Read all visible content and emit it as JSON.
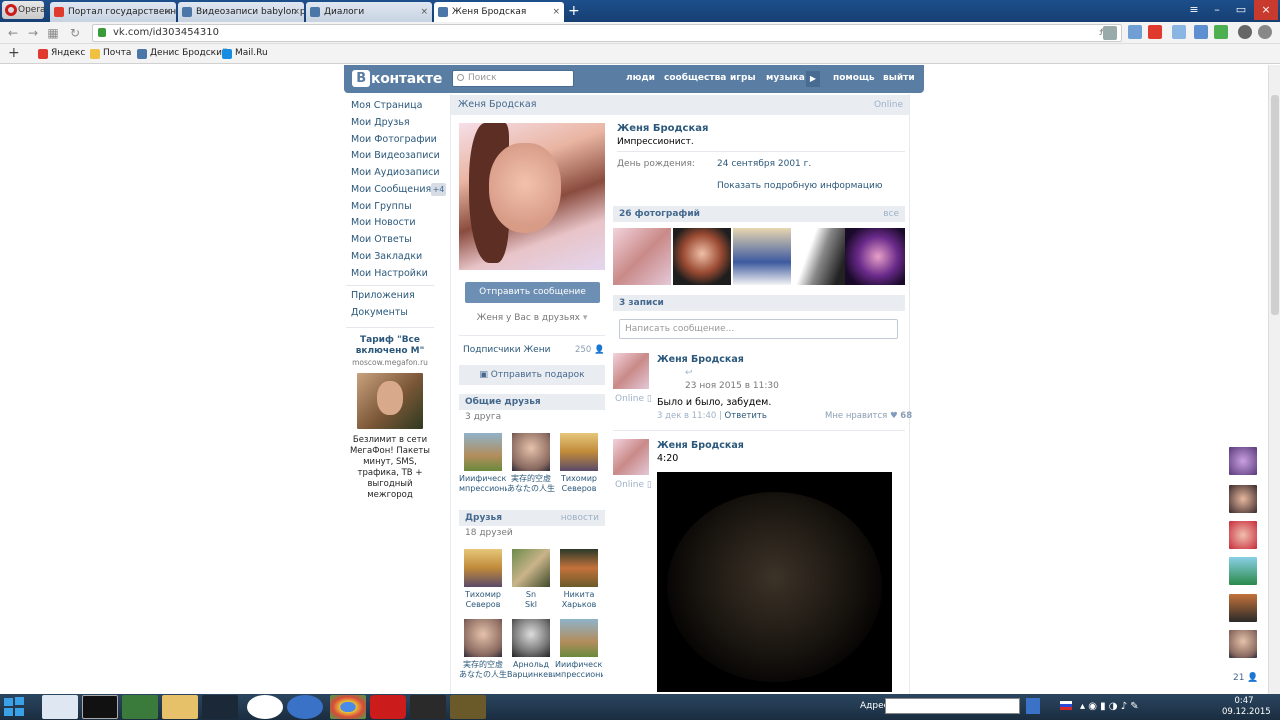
{
  "browser": {
    "opera_label": "Opera",
    "tabs": [
      {
        "title": "Портал государственных"
      },
      {
        "title": "Видеозаписи babylon po"
      },
      {
        "title": "Диалоги"
      },
      {
        "title": "Женя Бродская"
      }
    ],
    "new_tab": "+",
    "url": "vk.com/id303454310",
    "translate_label": "Ꝭ A",
    "bookmarks": [
      {
        "label": "Яндекс",
        "color": "#e03a2f"
      },
      {
        "label": "Почта",
        "color": "#f0c040"
      },
      {
        "label": "Денис Бродский",
        "color": "#4a76a8"
      },
      {
        "label": "Mail.Ru",
        "color": "#168de2"
      }
    ]
  },
  "vk_header": {
    "logo_box": "В",
    "logo_text": "контакте",
    "search_placeholder": "Поиск",
    "nav": [
      "люди",
      "сообщества",
      "игры",
      "музыка",
      "помощь",
      "выйти"
    ]
  },
  "left_menu": {
    "items": [
      "Моя Страница",
      "Мои Друзья",
      "Мои Фотографии",
      "Мои Видеозаписи",
      "Мои Аудиозаписи",
      "Мои Сообщения",
      "Мои Группы",
      "Мои Новости",
      "Мои Ответы",
      "Мои Закладки",
      "Мои Настройки"
    ],
    "messages_badge": "+4",
    "extra": [
      "Приложения",
      "Документы"
    ],
    "ad": {
      "title": "Тариф \"Все включено М\"",
      "domain": "moscow.megafon.ru",
      "text": "Безлимит в сети МегаФон! Пакеты минут, SMS, трафика, ТВ + выгодный межгород"
    }
  },
  "profile": {
    "title_name": "Женя Бродская",
    "title_online": "Online",
    "name": "Женя Бродская",
    "status": "Импрессионист.",
    "birthday_label": "День рождения:",
    "birthday_value": "24 сентября 2001 г.",
    "more_info": "Показать подробную информацию",
    "send_message": "Отправить сообщение",
    "friend_status": "Женя у Вас в друзьях",
    "subscribers_label": "Подписчики Жени",
    "subscribers_count": "250",
    "send_gift": "Отправить подарок",
    "common_friends": {
      "header": "Общие друзья",
      "count": "3 друга",
      "items": [
        {
          "name1": "Ииифический",
          "name2": "мпрессионис"
        },
        {
          "name1": "実存的空虚",
          "name2": "あなたの人生"
        },
        {
          "name1": "Тихомир",
          "name2": "Северов"
        }
      ]
    },
    "friends": {
      "header": "Друзья",
      "header_link": "новости",
      "count": "18 друзей",
      "items": [
        {
          "name1": "Тихомир",
          "name2": "Северов"
        },
        {
          "name1": "Sn",
          "name2": "Skl"
        },
        {
          "name1": "Никита",
          "name2": "Харьков"
        },
        {
          "name1": "実存的空虚",
          "name2": "あなたの人生"
        },
        {
          "name1": "Арнольд",
          "name2": "Варцинкевич"
        },
        {
          "name1": "Ииифический",
          "name2": "мпрессионис"
        }
      ]
    },
    "photos_header": "26 фотографий",
    "photos_all": "все",
    "wall_header": "3 записи",
    "wall_placeholder": "Написать сообщение...",
    "posts": [
      {
        "author": "Женя Бродская",
        "online": "Online",
        "date": "23 ноя 2015 в 11:30",
        "text": "Было и было, забудем.",
        "meta_date": "3 дек в 11:40",
        "reply": "Ответить",
        "likes_label": "Мне нравится",
        "likes": "68"
      },
      {
        "author": "Женя Бродская",
        "online": "Online",
        "text": "4:20"
      }
    ]
  },
  "sidebar_count": "21",
  "taskbar": {
    "address_label": "Адрес",
    "time": "0:47",
    "date": "09.12.2015"
  }
}
